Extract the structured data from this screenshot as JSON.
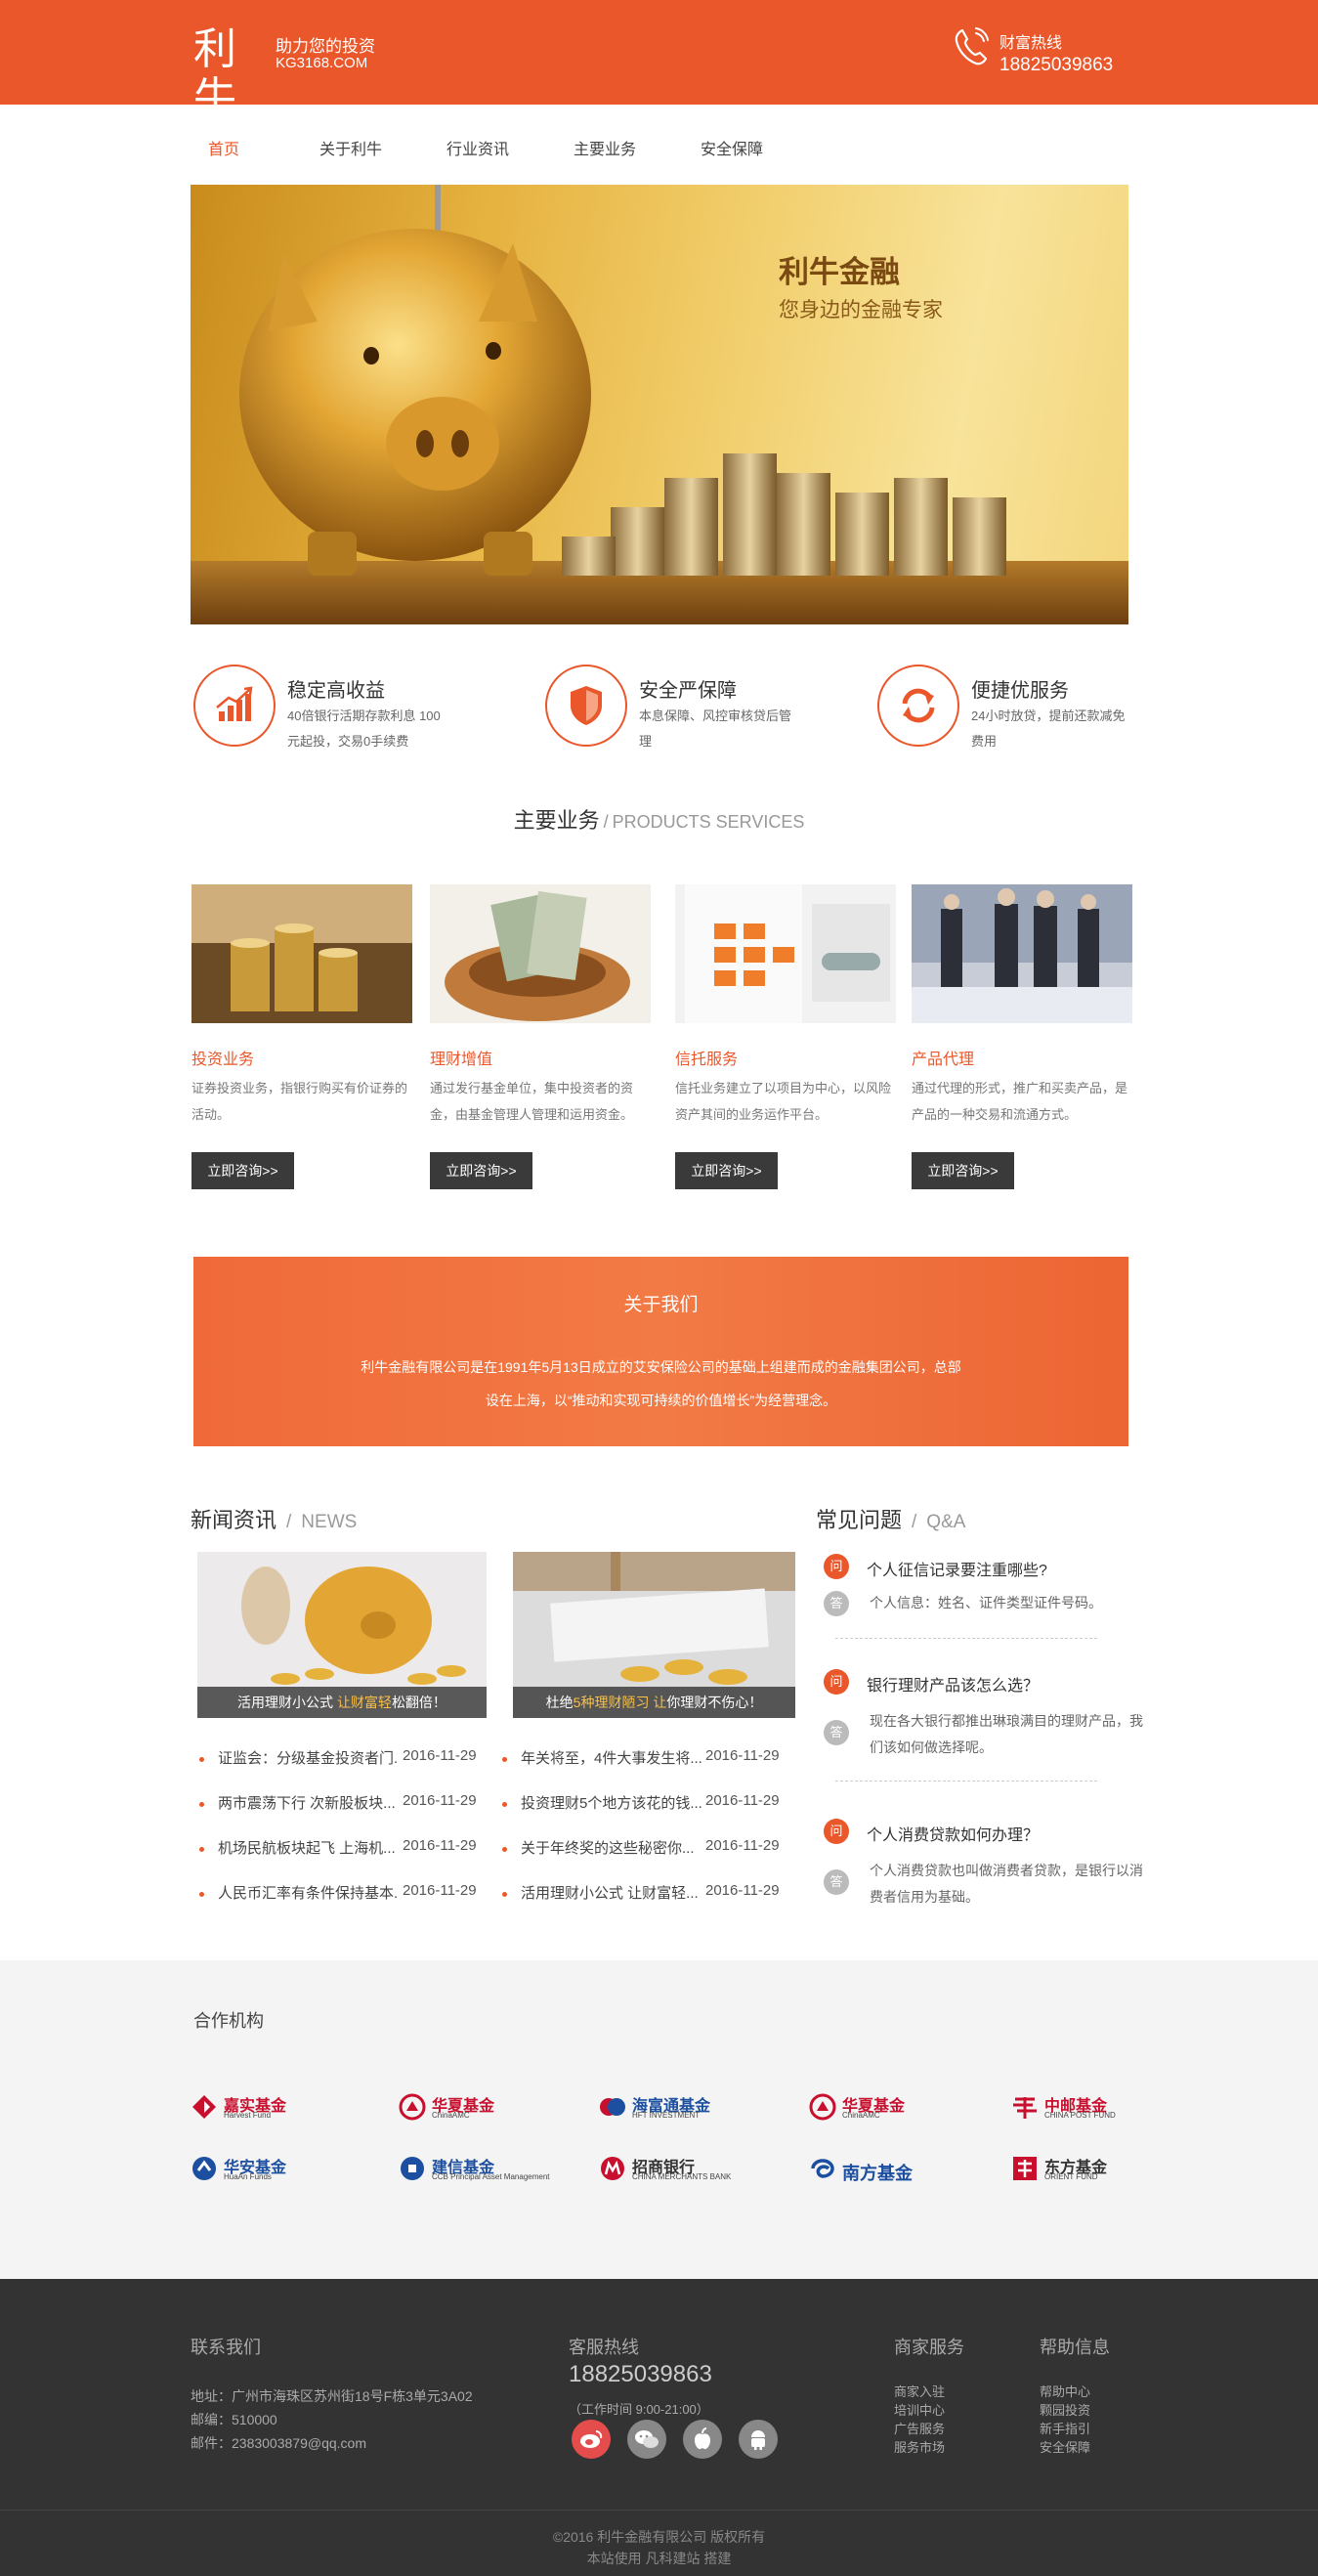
{
  "header": {
    "logo_main": "利牛",
    "logo_slogan": "助力您的投资",
    "logo_domain": "KG3168.COM",
    "hotline_label": "财富热线",
    "hotline_number": "18825039863"
  },
  "nav": {
    "items": [
      {
        "label": "首页",
        "active": true
      },
      {
        "label": "关于利牛"
      },
      {
        "label": "行业资讯"
      },
      {
        "label": "主要业务"
      },
      {
        "label": "安全保障"
      }
    ]
  },
  "banner": {
    "title": "利牛金融",
    "subtitle": "您身边的金融专家"
  },
  "features": [
    {
      "icon": "chart-up-icon",
      "title": "稳定高收益",
      "desc": "40倍银行活期存款利息 100元起投，交易0手续费"
    },
    {
      "icon": "shield-icon",
      "title": "安全严保障",
      "desc": "本息保障、风控审核贷后管理"
    },
    {
      "icon": "refresh-icon",
      "title": "便捷优服务",
      "desc": "24小时放贷，提前还款减免费用"
    }
  ],
  "products_section": {
    "title": "主要业务",
    "sep": "/",
    "title_en": "PRODUCTS SERVICES"
  },
  "products": [
    {
      "name": "投资业务",
      "desc": "证券投资业务，指银行购买有价证券的活动。",
      "button": "立即咨询>>"
    },
    {
      "name": "理财增值",
      "desc": "通过发行基金单位，集中投资者的资金，由基金管理人管理和运用资金。",
      "button": "立即咨询>>"
    },
    {
      "name": "信托服务",
      "desc": "信托业务建立了以项目为中心，以风险资产其间的业务运作平台。",
      "button": "立即咨询>>"
    },
    {
      "name": "产品代理",
      "desc": "通过代理的形式，推广和买卖产品，是产品的一种交易和流通方式。",
      "button": "立即咨询>>"
    }
  ],
  "about": {
    "title": "关于我们",
    "text": "利牛金融有限公司是在1991年5月13日成立的艾安保险公司的基础上组建而成的金融集团公司，总部设在上海，以“推动和实现可持续的价值增长”为经营理念。"
  },
  "news": {
    "title": "新闻资讯",
    "sep": "/",
    "title_en": "NEWS",
    "pics": [
      {
        "caption_pre": "活用理财小公式 ",
        "caption_hl": "让财富轻",
        "caption_post": "松翻倍！"
      },
      {
        "caption_pre": "杜绝",
        "caption_hl": "5种理财陋习 让",
        "caption_post": "你理财不伤心！"
      }
    ],
    "list_left": [
      {
        "title": "证监会：分级基金投资者门...",
        "date": "2016-11-29"
      },
      {
        "title": "两市震荡下行 次新股板块...",
        "date": "2016-11-29"
      },
      {
        "title": "机场民航板块起飞 上海机...",
        "date": "2016-11-29"
      },
      {
        "title": "人民币汇率有条件保持基本...",
        "date": "2016-11-29"
      }
    ],
    "list_right": [
      {
        "title": "年关将至，4件大事发生将...",
        "date": "2016-11-29"
      },
      {
        "title": "投资理财5个地方该花的钱...",
        "date": "2016-11-29"
      },
      {
        "title": "关于年终奖的这些秘密你...",
        "date": "2016-11-29"
      },
      {
        "title": "活用理财小公式 让财富轻...",
        "date": "2016-11-29"
      }
    ]
  },
  "faq": {
    "title": "常见问题",
    "sep": "/",
    "title_en": "Q&A",
    "q_badge": "问",
    "a_badge": "答",
    "items": [
      {
        "q": "个人征信记录要注重哪些?",
        "a": "个人信息：姓名、证件类型证件号码。"
      },
      {
        "q": "银行理财产品该怎么选？",
        "a": "现在各大银行都推出琳琅满目的理财产品，我们该如何做选择呢。"
      },
      {
        "q": "个人消费贷款如何办理？",
        "a": "个人消费贷款也叫做消费者贷款，是银行以消费者信用为基础。"
      }
    ]
  },
  "partners": {
    "title": "合作机构",
    "items": [
      {
        "cn": "嘉实基金",
        "en": "Harvest Fund",
        "color": "#c8102e"
      },
      {
        "cn": "华夏基金",
        "en": "ChinaAMC",
        "color": "#c8102e"
      },
      {
        "cn": "海富通基金",
        "en": "HFT INVESTMENT",
        "color": "#1c4fa0"
      },
      {
        "cn": "华夏基金",
        "en": "ChinaAMC",
        "color": "#c8102e"
      },
      {
        "cn": "中邮基金",
        "en": "CHINA POST FUND",
        "color": "#c8102e"
      },
      {
        "cn": "华安基金",
        "en": "HuaAn Funds",
        "color": "#1c4fa0"
      },
      {
        "cn": "建信基金",
        "en": "CCB Principal Asset Management",
        "color": "#1c4fa0"
      },
      {
        "cn": "招商银行",
        "en": "CHINA MERCHANTS BANK",
        "color": "#c8102e"
      },
      {
        "cn": "南方基金",
        "en": "",
        "color": "#1c4fa0"
      },
      {
        "cn": "东方基金",
        "en": "ORIENT FUND",
        "color": "#c8102e"
      }
    ]
  },
  "footer": {
    "contact_title": "联系我们",
    "address": "地址：广州市海珠区苏州街18号F栋3单元3A02",
    "zip": "邮编：510000",
    "email": "邮件：2383003879@qq.com",
    "hotline_title": "客服热线",
    "hotline_number": "18825039863",
    "hotline_hours": "（工作时间 9:00-21:00）",
    "service_title": "商家服务",
    "service_links": [
      "商家入驻",
      "培训中心",
      "广告服务",
      "服务市场"
    ],
    "help_title": "帮助信息",
    "help_links": [
      "帮助中心",
      "颗园投资",
      "新手指引",
      "安全保障"
    ],
    "copyright": "©2016 利牛金融有限公司 版权所有",
    "powered": "本站使用 凡科建站 搭建"
  }
}
